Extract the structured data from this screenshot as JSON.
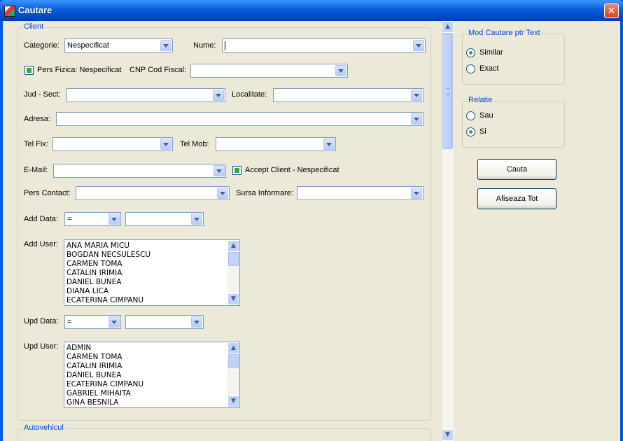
{
  "window": {
    "title": "Cautare",
    "close_glyph": "✕"
  },
  "client_group": {
    "title": "Client",
    "categorie_label": "Categorie:",
    "categorie_value": "Nespecificat",
    "nume_label": "Nume:",
    "nume_value": "",
    "pers_fizica_label": "Pers Fizica: Nespecificat",
    "cnp_label": "CNP Cod Fiscal:",
    "jud_label": "Jud - Sect:",
    "localitate_label": "Localitate:",
    "adresa_label": "Adresa:",
    "tel_fix_label": "Tel Fix:",
    "tel_mob_label": "Tel Mob:",
    "email_label": "E-Mail:",
    "accept_client_label": "Accept Client - Nespecificat",
    "pers_contact_label": "Pers Contact:",
    "sursa_label": "Sursa Informare:",
    "add_data_label": "Add Data:",
    "add_data_op": "=",
    "add_user_label": "Add User:",
    "add_users": [
      "ANA MARIA MICU",
      "BOGDAN NECSULESCU",
      "CARMEN TOMA",
      "CATALIN IRIMIA",
      "DANIEL BUNEA",
      "DIANA LICA",
      "ECATERINA CIMPANU"
    ],
    "upd_data_label": "Upd Data:",
    "upd_data_op": "=",
    "upd_user_label": "Upd User:",
    "upd_users": [
      "ADMIN",
      "CARMEN TOMA",
      "CATALIN IRIMIA",
      "DANIEL BUNEA",
      "ECATERINA CIMPANU",
      "GABRIEL MIHAITA",
      "GINA BESNILA"
    ]
  },
  "autovehicul_group": {
    "title": "Autovehicul"
  },
  "mod_cautare": {
    "title": "Mod Cautare ptr Text",
    "options": [
      {
        "label": "Similar",
        "checked": true
      },
      {
        "label": "Exact",
        "checked": false
      }
    ]
  },
  "relatie": {
    "title": "Relatie",
    "options": [
      {
        "label": "Sau",
        "checked": false
      },
      {
        "label": "Si",
        "checked": true
      }
    ]
  },
  "buttons": {
    "cauta": "Cauta",
    "afiseaza_tot": "Afiseaza Tot"
  }
}
